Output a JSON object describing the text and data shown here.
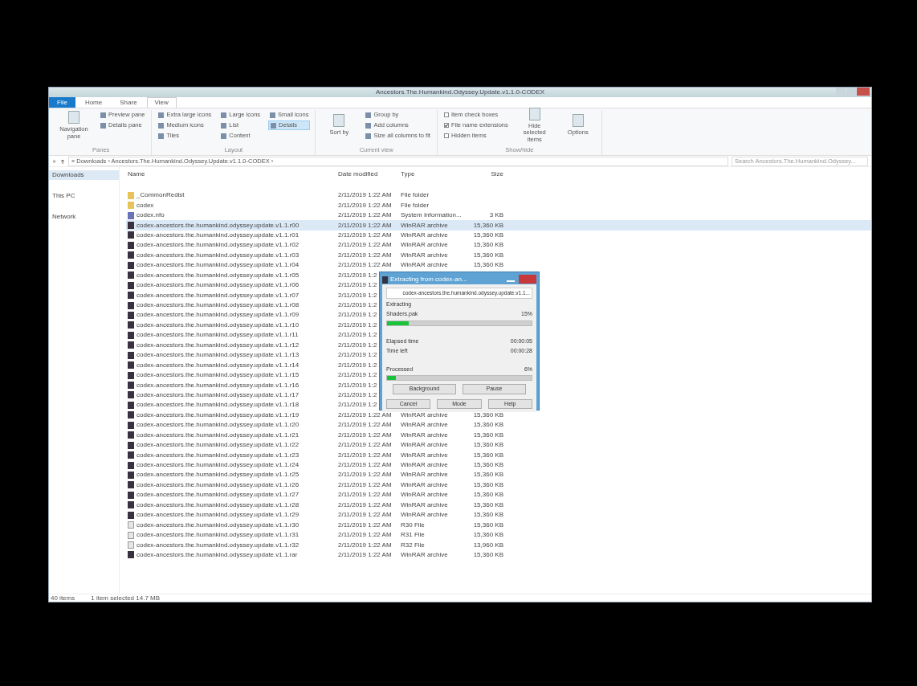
{
  "window": {
    "title": "Ancestors.The.Humankind.Odyssey.Update.v1.1.0-CODEX"
  },
  "tabs": [
    {
      "label": "File",
      "selected": false,
      "kind": "file"
    },
    {
      "label": "Home",
      "selected": false,
      "kind": "tab"
    },
    {
      "label": "Share",
      "selected": false,
      "kind": "tab"
    },
    {
      "label": "View",
      "selected": true,
      "kind": "tab"
    }
  ],
  "ribbon": [
    {
      "label": "Panes",
      "items": [
        {
          "label": "Navigation pane",
          "selected": false,
          "kind": "big"
        },
        {
          "label": "Preview pane",
          "selected": false,
          "kind": "small"
        },
        {
          "label": "Details pane",
          "selected": false,
          "kind": "small"
        }
      ]
    },
    {
      "label": "Layout",
      "items": [
        {
          "label": "Extra large icons",
          "selected": false,
          "kind": "small"
        },
        {
          "label": "Medium icons",
          "selected": false,
          "kind": "small"
        },
        {
          "label": "Tiles",
          "selected": false,
          "kind": "small"
        },
        {
          "label": "Large icons",
          "selected": false,
          "kind": "small"
        },
        {
          "label": "List",
          "selected": false,
          "kind": "small"
        },
        {
          "label": "Content",
          "selected": false,
          "kind": "small"
        },
        {
          "label": "Small icons",
          "selected": false,
          "kind": "small"
        },
        {
          "label": "Details",
          "selected": true,
          "kind": "small"
        }
      ]
    },
    {
      "label": "Current view",
      "items": [
        {
          "label": "Sort by",
          "selected": false,
          "kind": "big"
        },
        {
          "label": "Group by",
          "selected": false,
          "kind": "small"
        },
        {
          "label": "Add columns",
          "selected": false,
          "kind": "small"
        },
        {
          "label": "Size all columns to fit",
          "selected": false,
          "kind": "small"
        }
      ]
    },
    {
      "label": "Show/hide",
      "items": [
        {
          "label": "Item check boxes",
          "checked": false,
          "kind": "check"
        },
        {
          "label": "File name extensions",
          "checked": true,
          "kind": "check"
        },
        {
          "label": "Hidden items",
          "checked": false,
          "kind": "check"
        },
        {
          "label": "Hide selected items",
          "selected": false,
          "kind": "big"
        },
        {
          "label": "Options",
          "selected": false,
          "kind": "big"
        }
      ]
    }
  ],
  "address": {
    "path": "« Downloads › Ancestors.The.Humankind.Odyssey.Update.v1.1.0-CODEX ›",
    "search_placeholder": "Search Ancestors.The.Humankind.Odyssey..."
  },
  "sidebar": {
    "items": [
      {
        "label": "Downloads",
        "selected": true
      },
      {
        "label": "This PC",
        "selected": false
      },
      {
        "label": "Network",
        "selected": false
      }
    ]
  },
  "table": {
    "columns": [
      "Name",
      "Date modified",
      "Type",
      "Size"
    ],
    "rows": [
      {
        "kind": "folder",
        "name": "_CommonRedist",
        "date": "2/11/2019 1:22 AM",
        "type": "File folder",
        "selected": false
      },
      {
        "kind": "folder",
        "name": "codex",
        "date": "2/11/2019 1:22 AM",
        "type": "File folder",
        "selected": false
      },
      {
        "kind": "text",
        "name": "codex.nfo",
        "date": "2/11/2019 1:22 AM",
        "type": "System Information...",
        "size": "3 KB",
        "selected": false
      },
      {
        "kind": "archive",
        "name": "codex-ancestors.the.humankind.odyssey.update.v1.1.r00",
        "date": "2/11/2019 1:22 AM",
        "type": "WinRAR archive",
        "size": "15,360 KB",
        "selected": true
      },
      {
        "kind": "archive",
        "name": "codex-ancestors.the.humankind.odyssey.update.v1.1.r01",
        "date": "2/11/2019 1:22 AM",
        "type": "WinRAR archive",
        "size": "15,360 KB",
        "selected": false
      },
      {
        "kind": "archive",
        "name": "codex-ancestors.the.humankind.odyssey.update.v1.1.r02",
        "date": "2/11/2019 1:22 AM",
        "type": "WinRAR archive",
        "size": "15,360 KB",
        "selected": false
      },
      {
        "kind": "archive",
        "name": "codex-ancestors.the.humankind.odyssey.update.v1.1.r03",
        "date": "2/11/2019 1:22 AM",
        "type": "WinRAR archive",
        "size": "15,360 KB",
        "selected": false
      },
      {
        "kind": "archive",
        "name": "codex-ancestors.the.humankind.odyssey.update.v1.1.r04",
        "date": "2/11/2019 1:22 AM",
        "type": "WinRAR archive",
        "size": "15,360 KB",
        "selected": false
      },
      {
        "kind": "archive",
        "name": "codex-ancestors.the.humankind.odyssey.update.v1.1.r05",
        "date": "2/11/2019 1:2",
        "selected": false
      },
      {
        "kind": "archive",
        "name": "codex-ancestors.the.humankind.odyssey.update.v1.1.r06",
        "date": "2/11/2019 1:2",
        "selected": false
      },
      {
        "kind": "archive",
        "name": "codex-ancestors.the.humankind.odyssey.update.v1.1.r07",
        "date": "2/11/2019 1:2",
        "selected": false
      },
      {
        "kind": "archive",
        "name": "codex-ancestors.the.humankind.odyssey.update.v1.1.r08",
        "date": "2/11/2019 1:2",
        "selected": false
      },
      {
        "kind": "archive",
        "name": "codex-ancestors.the.humankind.odyssey.update.v1.1.r09",
        "date": "2/11/2019 1:2",
        "selected": false
      },
      {
        "kind": "archive",
        "name": "codex-ancestors.the.humankind.odyssey.update.v1.1.r10",
        "date": "2/11/2019 1:2",
        "selected": false
      },
      {
        "kind": "archive",
        "name": "codex-ancestors.the.humankind.odyssey.update.v1.1.r11",
        "date": "2/11/2019 1:2",
        "selected": false
      },
      {
        "kind": "archive",
        "name": "codex-ancestors.the.humankind.odyssey.update.v1.1.r12",
        "date": "2/11/2019 1:2",
        "selected": false
      },
      {
        "kind": "archive",
        "name": "codex-ancestors.the.humankind.odyssey.update.v1.1.r13",
        "date": "2/11/2019 1:2",
        "selected": false
      },
      {
        "kind": "archive",
        "name": "codex-ancestors.the.humankind.odyssey.update.v1.1.r14",
        "date": "2/11/2019 1:2",
        "selected": false
      },
      {
        "kind": "archive",
        "name": "codex-ancestors.the.humankind.odyssey.update.v1.1.r15",
        "date": "2/11/2019 1:2",
        "selected": false
      },
      {
        "kind": "archive",
        "name": "codex-ancestors.the.humankind.odyssey.update.v1.1.r16",
        "date": "2/11/2019 1:2",
        "selected": false
      },
      {
        "kind": "archive",
        "name": "codex-ancestors.the.humankind.odyssey.update.v1.1.r17",
        "date": "2/11/2019 1:2",
        "selected": false
      },
      {
        "kind": "archive",
        "name": "codex-ancestors.the.humankind.odyssey.update.v1.1.r18",
        "date": "2/11/2019 1:2",
        "selected": false
      },
      {
        "kind": "archive",
        "name": "codex-ancestors.the.humankind.odyssey.update.v1.1.r19",
        "date": "2/11/2019 1:22 AM",
        "type": "WinRAR archive",
        "size": "15,360 KB",
        "selected": false
      },
      {
        "kind": "archive",
        "name": "codex-ancestors.the.humankind.odyssey.update.v1.1.r20",
        "date": "2/11/2019 1:22 AM",
        "type": "WinRAR archive",
        "size": "15,360 KB",
        "selected": false
      },
      {
        "kind": "archive",
        "name": "codex-ancestors.the.humankind.odyssey.update.v1.1.r21",
        "date": "2/11/2019 1:22 AM",
        "type": "WinRAR archive",
        "size": "15,360 KB",
        "selected": false
      },
      {
        "kind": "archive",
        "name": "codex-ancestors.the.humankind.odyssey.update.v1.1.r22",
        "date": "2/11/2019 1:22 AM",
        "type": "WinRAR archive",
        "size": "15,360 KB",
        "selected": false
      },
      {
        "kind": "archive",
        "name": "codex-ancestors.the.humankind.odyssey.update.v1.1.r23",
        "date": "2/11/2019 1:22 AM",
        "type": "WinRAR archive",
        "size": "15,360 KB",
        "selected": false
      },
      {
        "kind": "archive",
        "name": "codex-ancestors.the.humankind.odyssey.update.v1.1.r24",
        "date": "2/11/2019 1:22 AM",
        "type": "WinRAR archive",
        "size": "15,360 KB",
        "selected": false
      },
      {
        "kind": "archive",
        "name": "codex-ancestors.the.humankind.odyssey.update.v1.1.r25",
        "date": "2/11/2019 1:22 AM",
        "type": "WinRAR archive",
        "size": "15,360 KB",
        "selected": false
      },
      {
        "kind": "archive",
        "name": "codex-ancestors.the.humankind.odyssey.update.v1.1.r26",
        "date": "2/11/2019 1:22 AM",
        "type": "WinRAR archive",
        "size": "15,360 KB",
        "selected": false
      },
      {
        "kind": "archive",
        "name": "codex-ancestors.the.humankind.odyssey.update.v1.1.r27",
        "date": "2/11/2019 1:22 AM",
        "type": "WinRAR archive",
        "size": "15,360 KB",
        "selected": false
      },
      {
        "kind": "archive",
        "name": "codex-ancestors.the.humankind.odyssey.update.v1.1.r28",
        "date": "2/11/2019 1:22 AM",
        "type": "WinRAR archive",
        "size": "15,360 KB",
        "selected": false
      },
      {
        "kind": "archive",
        "name": "codex-ancestors.the.humankind.odyssey.update.v1.1.r29",
        "date": "2/11/2019 1:22 AM",
        "type": "WinRAR archive",
        "size": "15,360 KB",
        "selected": false
      },
      {
        "kind": "file",
        "name": "codex-ancestors.the.humankind.odyssey.update.v1.1.r30",
        "date": "2/11/2019 1:22 AM",
        "type": "R30 File",
        "size": "15,360 KB",
        "selected": false
      },
      {
        "kind": "file",
        "name": "codex-ancestors.the.humankind.odyssey.update.v1.1.r31",
        "date": "2/11/2019 1:22 AM",
        "type": "R31 File",
        "size": "15,360 KB",
        "selected": false
      },
      {
        "kind": "file",
        "name": "codex-ancestors.the.humankind.odyssey.update.v1.1.r32",
        "date": "2/11/2019 1:22 AM",
        "type": "R32 File",
        "size": "13,960 KB",
        "selected": false
      },
      {
        "kind": "archive",
        "name": "codex-ancestors.the.humankind.odyssey.update.v1.1.rar",
        "date": "2/11/2019 1:22 AM",
        "type": "WinRAR archive",
        "size": "15,360 KB",
        "selected": false
      }
    ]
  },
  "status_bar": {
    "count": "40 items",
    "selection": "1 item selected  14.7 MB"
  },
  "dialog": {
    "title": "Extracting from codex-an...",
    "archive": "codex-ancestors.the.humankind.odyssey.update.v1.1...",
    "action": "Extracting",
    "file": "Shaders.pak",
    "file_percent": "15%",
    "file_bar": {
      "level": 0.15
    },
    "elapsed_label": "Elapsed time",
    "elapsed": "00:00:05",
    "left_label": "Time left",
    "left": "00:00:28",
    "processed_label": "Processed",
    "processed_percent": "6%",
    "processed_bar": {
      "level": 0.06
    },
    "button_rows": [
      [
        "Background",
        "Pause"
      ],
      [
        "Cancel",
        "Mode",
        "Help"
      ]
    ]
  }
}
